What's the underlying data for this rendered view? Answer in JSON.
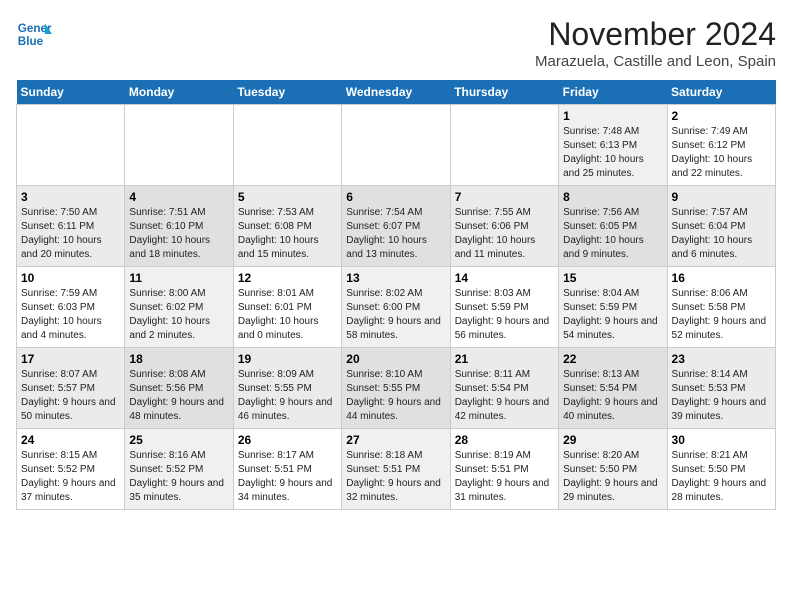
{
  "logo": {
    "line1": "General",
    "line2": "Blue"
  },
  "title": "November 2024",
  "subtitle": "Marazuela, Castille and Leon, Spain",
  "days_of_week": [
    "Sunday",
    "Monday",
    "Tuesday",
    "Wednesday",
    "Thursday",
    "Friday",
    "Saturday"
  ],
  "weeks": [
    [
      {
        "day": "",
        "info": ""
      },
      {
        "day": "",
        "info": ""
      },
      {
        "day": "",
        "info": ""
      },
      {
        "day": "",
        "info": ""
      },
      {
        "day": "",
        "info": ""
      },
      {
        "day": "1",
        "info": "Sunrise: 7:48 AM\nSunset: 6:13 PM\nDaylight: 10 hours and 25 minutes."
      },
      {
        "day": "2",
        "info": "Sunrise: 7:49 AM\nSunset: 6:12 PM\nDaylight: 10 hours and 22 minutes."
      }
    ],
    [
      {
        "day": "3",
        "info": "Sunrise: 7:50 AM\nSunset: 6:11 PM\nDaylight: 10 hours and 20 minutes."
      },
      {
        "day": "4",
        "info": "Sunrise: 7:51 AM\nSunset: 6:10 PM\nDaylight: 10 hours and 18 minutes."
      },
      {
        "day": "5",
        "info": "Sunrise: 7:53 AM\nSunset: 6:08 PM\nDaylight: 10 hours and 15 minutes."
      },
      {
        "day": "6",
        "info": "Sunrise: 7:54 AM\nSunset: 6:07 PM\nDaylight: 10 hours and 13 minutes."
      },
      {
        "day": "7",
        "info": "Sunrise: 7:55 AM\nSunset: 6:06 PM\nDaylight: 10 hours and 11 minutes."
      },
      {
        "day": "8",
        "info": "Sunrise: 7:56 AM\nSunset: 6:05 PM\nDaylight: 10 hours and 9 minutes."
      },
      {
        "day": "9",
        "info": "Sunrise: 7:57 AM\nSunset: 6:04 PM\nDaylight: 10 hours and 6 minutes."
      }
    ],
    [
      {
        "day": "10",
        "info": "Sunrise: 7:59 AM\nSunset: 6:03 PM\nDaylight: 10 hours and 4 minutes."
      },
      {
        "day": "11",
        "info": "Sunrise: 8:00 AM\nSunset: 6:02 PM\nDaylight: 10 hours and 2 minutes."
      },
      {
        "day": "12",
        "info": "Sunrise: 8:01 AM\nSunset: 6:01 PM\nDaylight: 10 hours and 0 minutes."
      },
      {
        "day": "13",
        "info": "Sunrise: 8:02 AM\nSunset: 6:00 PM\nDaylight: 9 hours and 58 minutes."
      },
      {
        "day": "14",
        "info": "Sunrise: 8:03 AM\nSunset: 5:59 PM\nDaylight: 9 hours and 56 minutes."
      },
      {
        "day": "15",
        "info": "Sunrise: 8:04 AM\nSunset: 5:59 PM\nDaylight: 9 hours and 54 minutes."
      },
      {
        "day": "16",
        "info": "Sunrise: 8:06 AM\nSunset: 5:58 PM\nDaylight: 9 hours and 52 minutes."
      }
    ],
    [
      {
        "day": "17",
        "info": "Sunrise: 8:07 AM\nSunset: 5:57 PM\nDaylight: 9 hours and 50 minutes."
      },
      {
        "day": "18",
        "info": "Sunrise: 8:08 AM\nSunset: 5:56 PM\nDaylight: 9 hours and 48 minutes."
      },
      {
        "day": "19",
        "info": "Sunrise: 8:09 AM\nSunset: 5:55 PM\nDaylight: 9 hours and 46 minutes."
      },
      {
        "day": "20",
        "info": "Sunrise: 8:10 AM\nSunset: 5:55 PM\nDaylight: 9 hours and 44 minutes."
      },
      {
        "day": "21",
        "info": "Sunrise: 8:11 AM\nSunset: 5:54 PM\nDaylight: 9 hours and 42 minutes."
      },
      {
        "day": "22",
        "info": "Sunrise: 8:13 AM\nSunset: 5:54 PM\nDaylight: 9 hours and 40 minutes."
      },
      {
        "day": "23",
        "info": "Sunrise: 8:14 AM\nSunset: 5:53 PM\nDaylight: 9 hours and 39 minutes."
      }
    ],
    [
      {
        "day": "24",
        "info": "Sunrise: 8:15 AM\nSunset: 5:52 PM\nDaylight: 9 hours and 37 minutes."
      },
      {
        "day": "25",
        "info": "Sunrise: 8:16 AM\nSunset: 5:52 PM\nDaylight: 9 hours and 35 minutes."
      },
      {
        "day": "26",
        "info": "Sunrise: 8:17 AM\nSunset: 5:51 PM\nDaylight: 9 hours and 34 minutes."
      },
      {
        "day": "27",
        "info": "Sunrise: 8:18 AM\nSunset: 5:51 PM\nDaylight: 9 hours and 32 minutes."
      },
      {
        "day": "28",
        "info": "Sunrise: 8:19 AM\nSunset: 5:51 PM\nDaylight: 9 hours and 31 minutes."
      },
      {
        "day": "29",
        "info": "Sunrise: 8:20 AM\nSunset: 5:50 PM\nDaylight: 9 hours and 29 minutes."
      },
      {
        "day": "30",
        "info": "Sunrise: 8:21 AM\nSunset: 5:50 PM\nDaylight: 9 hours and 28 minutes."
      }
    ]
  ]
}
